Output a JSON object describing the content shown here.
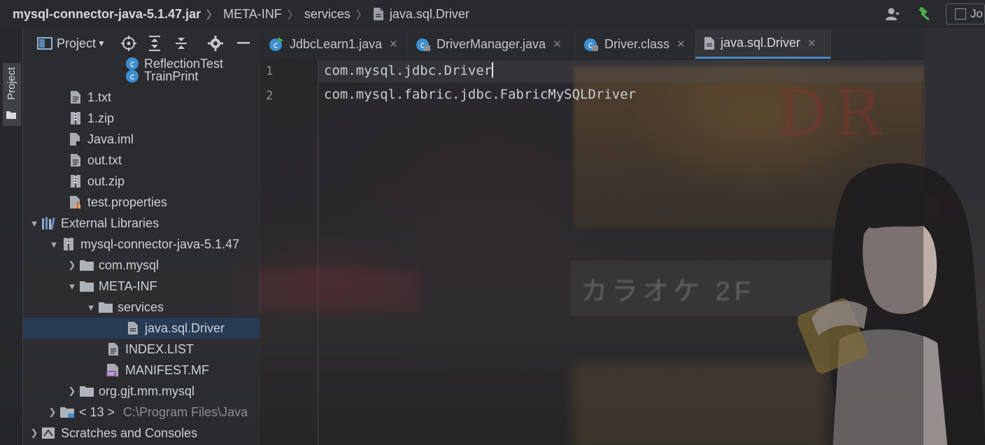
{
  "breadcrumb": {
    "items": [
      {
        "label": "mysql-connector-java-5.1.47.jar",
        "icon": "jar-icon"
      },
      {
        "label": "META-INF",
        "icon": "folder-icon"
      },
      {
        "label": "services",
        "icon": "folder-icon"
      },
      {
        "label": "java.sql.Driver",
        "icon": "file-icon"
      }
    ],
    "right_truncated": "Jo"
  },
  "toolwindow": {
    "project_label": "Project"
  },
  "project_panel": {
    "view_label": "Project",
    "tree": [
      {
        "label": "ReflectionTest",
        "icon": "class-icon"
      },
      {
        "label": "TrainPrint",
        "icon": "class-icon"
      },
      {
        "label": "1.txt",
        "icon": "text-file-icon"
      },
      {
        "label": "1.zip",
        "icon": "archive-icon"
      },
      {
        "label": "Java.iml",
        "icon": "module-file-icon"
      },
      {
        "label": "out.txt",
        "icon": "text-file-icon"
      },
      {
        "label": "out.zip",
        "icon": "archive-icon"
      },
      {
        "label": "test.properties",
        "icon": "properties-file-icon"
      },
      {
        "label": "External Libraries",
        "icon": "libraries-icon",
        "expanded": true
      },
      {
        "label": "mysql-connector-java-5.1.47",
        "icon": "jar-icon",
        "expanded": true
      },
      {
        "label": "com.mysql",
        "icon": "folder-icon",
        "expanded": false
      },
      {
        "label": "META-INF",
        "icon": "folder-icon",
        "expanded": true
      },
      {
        "label": "services",
        "icon": "folder-icon",
        "expanded": true
      },
      {
        "label": "java.sql.Driver",
        "icon": "file-icon",
        "selected": true
      },
      {
        "label": "INDEX.LIST",
        "icon": "text-file-icon"
      },
      {
        "label": "MANIFEST.MF",
        "icon": "manifest-icon"
      },
      {
        "label": "org.gjt.mm.mysql",
        "icon": "folder-icon",
        "expanded": false
      },
      {
        "label": "< 13 >",
        "icon": "jdk-folder-icon",
        "expanded": false,
        "path": "C:\\Program Files\\Java"
      },
      {
        "label": "Scratches and Consoles",
        "icon": "scratches-icon",
        "expanded": false
      }
    ]
  },
  "editor": {
    "tabs": [
      {
        "label": "JdbcLearn1.java",
        "icon": "java-class-icon",
        "active": false
      },
      {
        "label": "DriverManager.java",
        "icon": "java-class-icon",
        "active": false
      },
      {
        "label": "Driver.class",
        "icon": "java-class-icon",
        "active": false
      },
      {
        "label": "java.sql.Driver",
        "icon": "file-icon",
        "active": true
      }
    ],
    "line_numbers": [
      "1",
      "2"
    ],
    "lines": [
      "com.mysql.jdbc.Driver",
      "com.mysql.fabric.jdbc.FabricMySQLDriver"
    ]
  },
  "colors": {
    "accent": "#4a88c7",
    "selection": "#283e5c",
    "class_icon": "#3d8fd0",
    "build_icon": "#4caf50"
  }
}
